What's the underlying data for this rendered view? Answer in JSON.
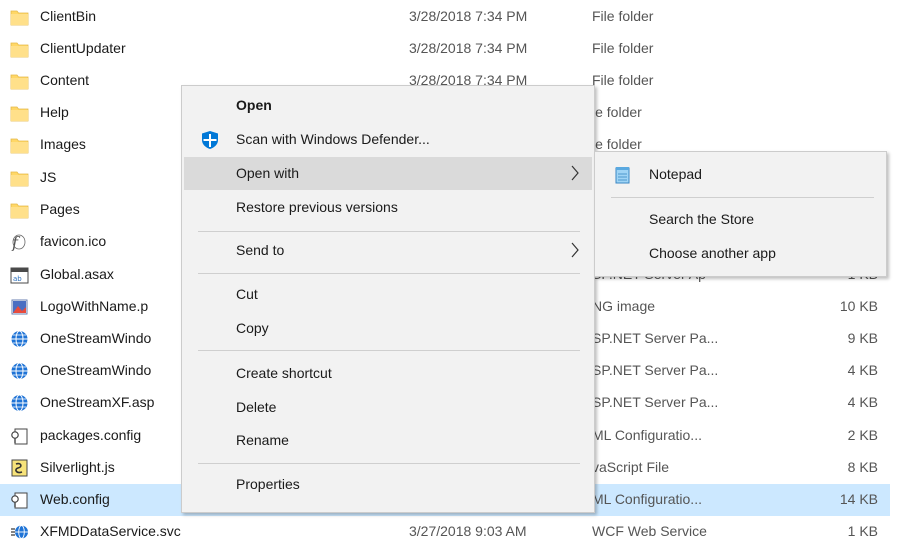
{
  "files": [
    {
      "name": "ClientBin",
      "date": "3/28/2018 7:34 PM",
      "type": "File folder",
      "size": "",
      "icon": "folder-icon"
    },
    {
      "name": "ClientUpdater",
      "date": "3/28/2018 7:34 PM",
      "type": "File folder",
      "size": "",
      "icon": "folder-icon"
    },
    {
      "name": "Content",
      "date": "3/28/2018 7:34 PM",
      "type": "File folder",
      "size": "",
      "icon": "folder-icon"
    },
    {
      "name": "Help",
      "date": "",
      "type": "le folder",
      "size": "",
      "icon": "folder-icon"
    },
    {
      "name": "Images",
      "date": "",
      "type": "le folder",
      "size": "",
      "icon": "folder-icon"
    },
    {
      "name": "JS",
      "date": "",
      "type": "",
      "size": "",
      "icon": "folder-icon"
    },
    {
      "name": "Pages",
      "date": "",
      "type": "",
      "size": "",
      "icon": "folder-icon"
    },
    {
      "name": "favicon.ico",
      "date": "",
      "type": "",
      "size": "",
      "icon": "favicon-file-icon"
    },
    {
      "name": "Global.asax",
      "date": "",
      "type": "SP.NET Server Ap",
      "size": "1 KB",
      "icon": "asax-file-icon"
    },
    {
      "name": "LogoWithName.p",
      "date": "",
      "type": "NG image",
      "size": "10 KB",
      "icon": "png-file-icon"
    },
    {
      "name": "OneStreamWindo",
      "date": "",
      "type": "SP.NET Server Pa...",
      "size": "9 KB",
      "icon": "aspx-file-icon"
    },
    {
      "name": "OneStreamWindo",
      "date": "",
      "type": "SP.NET Server Pa...",
      "size": "4 KB",
      "icon": "aspx-file-icon"
    },
    {
      "name": "OneStreamXF.asp",
      "date": "",
      "type": "SP.NET Server Pa...",
      "size": "4 KB",
      "icon": "aspx-file-icon"
    },
    {
      "name": "packages.config",
      "date": "",
      "type": "ML Configuratio...",
      "size": "2 KB",
      "icon": "config-file-icon"
    },
    {
      "name": "Silverlight.js",
      "date": "",
      "type": "vaScript File",
      "size": "8 KB",
      "icon": "js-file-icon"
    },
    {
      "name": "Web.config",
      "date": "",
      "type": "ML Configuratio...",
      "size": "14 KB",
      "icon": "config-file-icon"
    },
    {
      "name": "XFMDDataService.svc",
      "date": "3/27/2018 9:03 AM",
      "type": "WCF Web Service",
      "size": "1 KB",
      "icon": "svc-file-icon"
    }
  ],
  "context_menu": {
    "open": "Open",
    "scan": "Scan with Windows Defender...",
    "open_with": "Open with",
    "restore": "Restore previous versions",
    "send_to": "Send to",
    "cut": "Cut",
    "copy": "Copy",
    "create_shortcut": "Create shortcut",
    "delete": "Delete",
    "rename": "Rename",
    "properties": "Properties"
  },
  "submenu": {
    "notepad": "Notepad",
    "search_store": "Search the Store",
    "choose_app": "Choose another app"
  },
  "colors": {
    "selection": "#cce8ff",
    "menu_bg": "#f2f2f2",
    "menu_hover": "#dadada",
    "folder": "#ffd767",
    "defender_blue": "#0078d7"
  }
}
